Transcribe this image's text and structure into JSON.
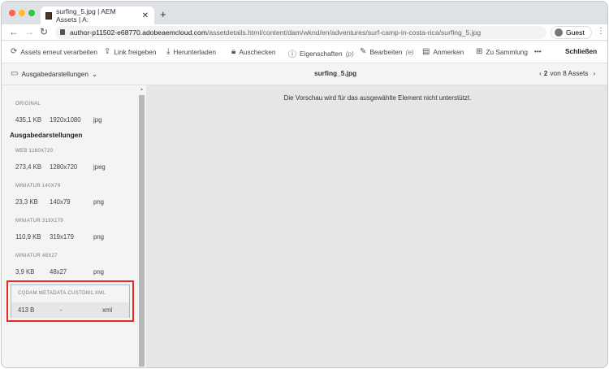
{
  "browser": {
    "tab_title": "surfing_5.jpg | AEM Assets | A:",
    "url_host": "author-p11502-e68770.adobeaemcloud.com",
    "url_path": "/assetdetails.html/content/dam/wknd/en/adventures/surf-camp-in-costa-rica/surfing_5.jpg",
    "profile": "Guest"
  },
  "toolbar": {
    "reprocess": "Assets erneut verarbeiten",
    "share": "Link freigeben",
    "download": "Herunterladen",
    "checkout": "Auschecken",
    "properties": "Eigenschaften",
    "properties_key": "(p)",
    "edit": "Bearbeiten",
    "edit_key": "(e)",
    "annotate": "Anmerken",
    "collection": "Zu Sammlung",
    "more": "•••",
    "close": "Schließen"
  },
  "header": {
    "rail_selector": "Ausgabedarstellungen",
    "file_name": "surfing_5.jpg",
    "page_current": "2",
    "page_rest": "von 8 Assets"
  },
  "preview": {
    "message": "Die Vorschau wird für das ausgewählte Element nicht unterstützt."
  },
  "renditions": {
    "original": {
      "label": "ORIGINAL",
      "size": "435,1 KB",
      "dims": "1920x1080",
      "format": "jpg"
    },
    "section_title": "Ausgabedarstellungen",
    "items": [
      {
        "label": "WEB 1280X720",
        "size": "273,4 KB",
        "dims": "1280x720",
        "format": "jpeg"
      },
      {
        "label": "MINIATUR 140X79",
        "size": "23,3 KB",
        "dims": "140x79",
        "format": "png"
      },
      {
        "label": "MINIATUR 319X179",
        "size": "110,9 KB",
        "dims": "319x179",
        "format": "png"
      },
      {
        "label": "MINIATUR 48X27",
        "size": "3,9 KB",
        "dims": "48x27",
        "format": "png"
      }
    ],
    "selected": {
      "label": "CQDAM.METADATA.CUSTOM1.XML",
      "size": "413 B",
      "dims": "-",
      "format": "xml"
    }
  }
}
